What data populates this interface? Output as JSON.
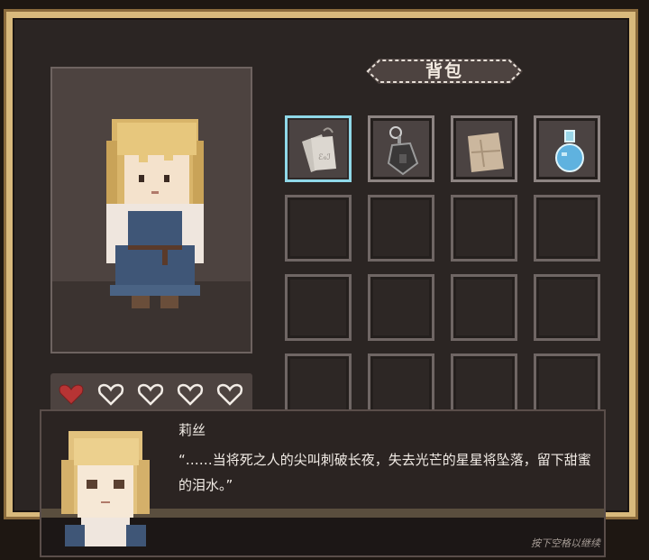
{
  "inventory": {
    "title": "背包",
    "slots": [
      {
        "icon": "paper-note-icon",
        "filled": true,
        "selected": true
      },
      {
        "icon": "lantern-icon",
        "filled": true,
        "selected": false
      },
      {
        "icon": "cloth-scrap-icon",
        "filled": true,
        "selected": false
      },
      {
        "icon": "blue-potion-icon",
        "filled": true,
        "selected": false
      }
    ]
  },
  "status": {
    "hearts_total": 5,
    "hearts_filled": 1,
    "heart_color": "#b73434"
  },
  "dialog": {
    "speaker": "莉丝",
    "text": "“……当将死之人的尖叫刺破长夜，失去光芒的星星将坠落，留下甜蜜的泪水。”",
    "hint": "按下空格以继续"
  },
  "colors": {
    "frame": "#d8b97c",
    "panel": "#2b2523",
    "selected_border": "#8fd8e8"
  }
}
